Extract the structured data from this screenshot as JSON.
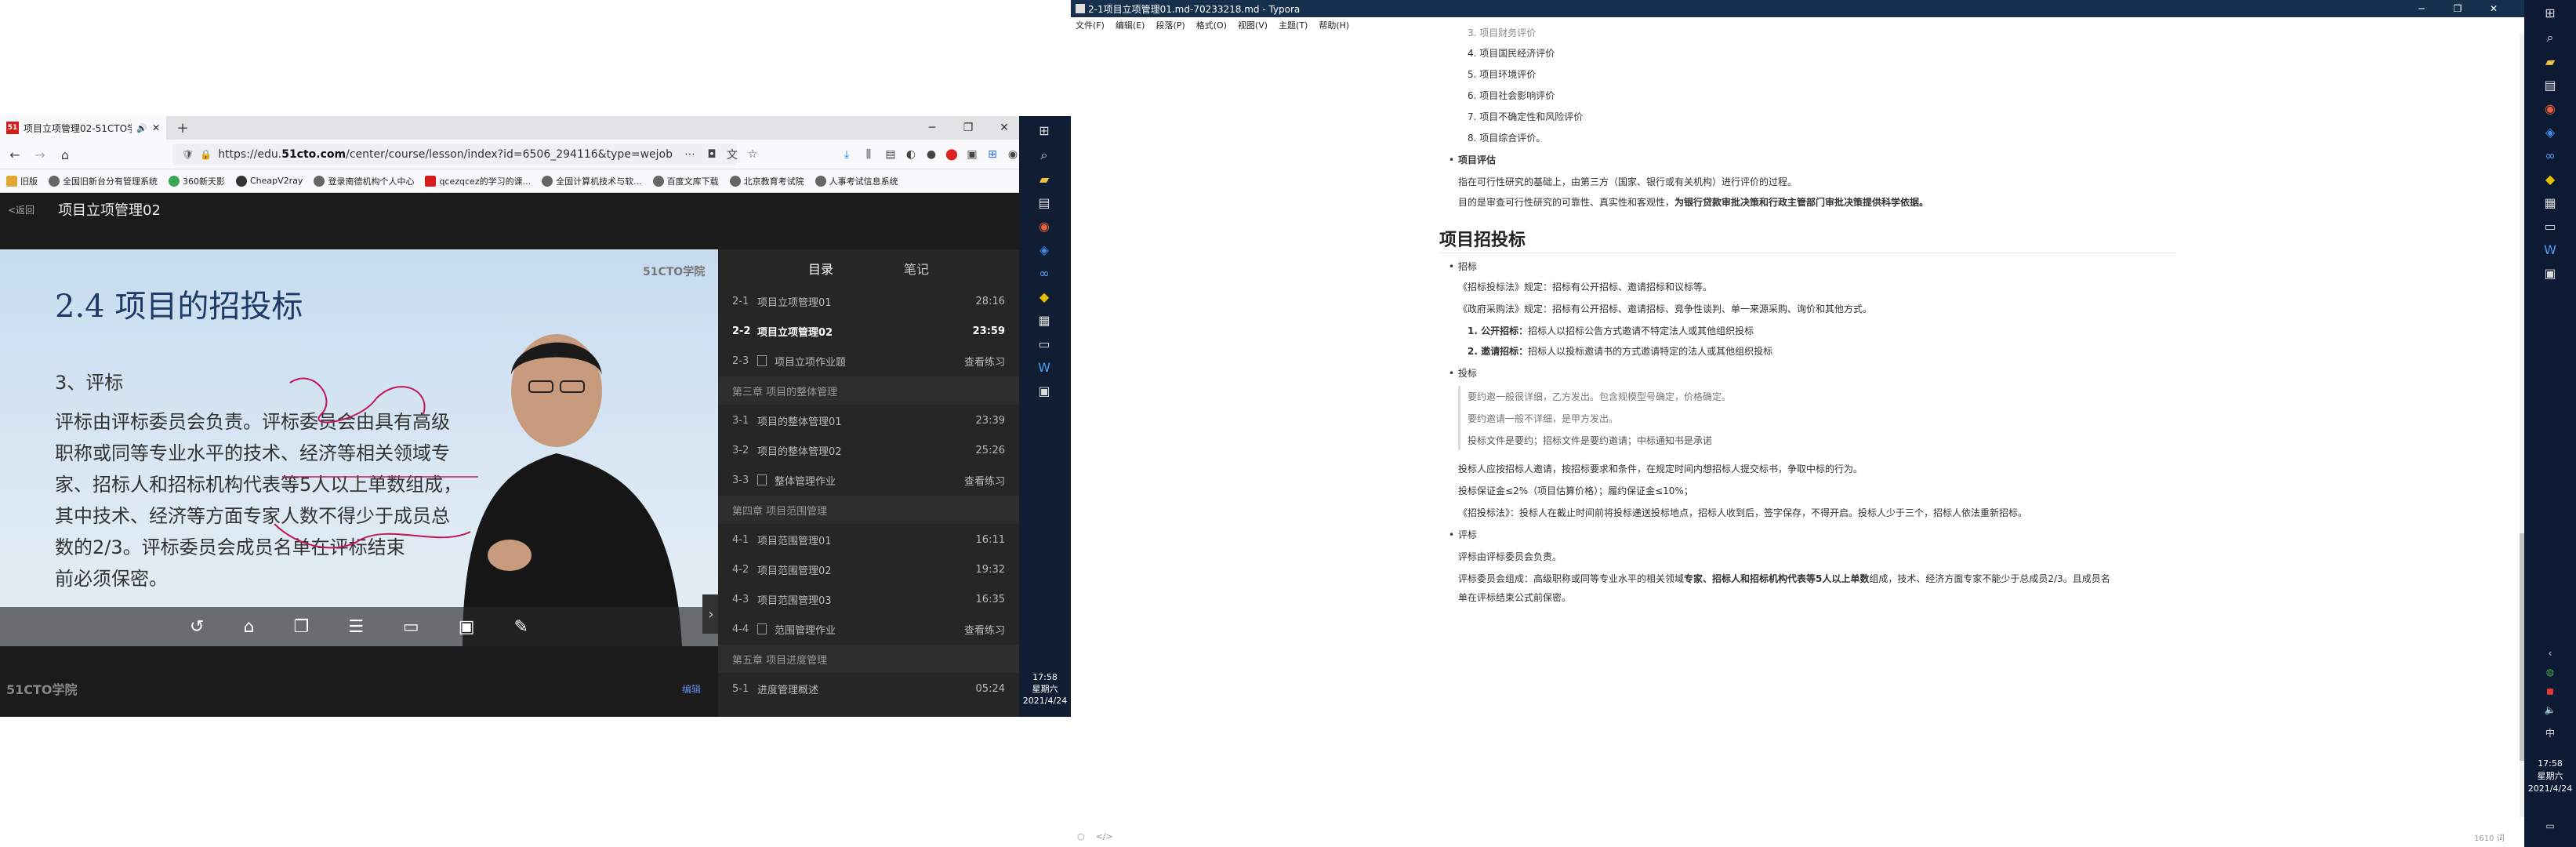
{
  "firefox": {
    "tab_title": "项目立项管理02-51CTO学",
    "url_prefix": "https://edu.",
    "url_host": "51cto.com",
    "url_path": "/center/course/lesson/index?id=6506_294116&type=wejob",
    "bookmarks": [
      "旧版",
      "全国旧新台分有管理系统",
      "360新天影",
      "CheapV2ray",
      "登录南德机构个人中心",
      "qcezqcez的学习的课...",
      "全国计算机技术与软...",
      "百度文库下载",
      "北京教育考试院",
      "人事考试信息系统"
    ]
  },
  "page": {
    "back_label": "<返回",
    "title": "项目立项管理02"
  },
  "video": {
    "slide_heading": "2.4   项目的招投标",
    "slide_logo": "51CTO学院",
    "slide_section": "3、评标",
    "slide_lines": [
      "评标由评标委员会负责。评标委员会由具有高级",
      "职称或同等专业水平的技术、经济等相关领域专",
      "家、招标人和招标机构代表等5人以上单数组成，",
      "其中技术、经济等方面专家人数不得少于成员总",
      "数的2/3。评标委员会成员名单在评标结束",
      "前必须保密。"
    ],
    "brand": "51CTO学院",
    "edit_label": "编辑"
  },
  "playlist": {
    "tabs": [
      "目录",
      "笔记"
    ],
    "items": [
      {
        "kind": "lesson",
        "num": "2-1",
        "name": "项目立项管理01",
        "right": "28:16",
        "current": false
      },
      {
        "kind": "lesson",
        "num": "2-2",
        "name": "项目立项管理02",
        "right": "23:59",
        "current": true
      },
      {
        "kind": "exercise",
        "num": "2-3",
        "name": "项目立项作业题",
        "right": "查看练习",
        "current": false
      },
      {
        "kind": "chapter",
        "name": "第三章 项目的整体管理"
      },
      {
        "kind": "lesson",
        "num": "3-1",
        "name": "项目的整体管理01",
        "right": "23:39",
        "current": false
      },
      {
        "kind": "lesson",
        "num": "3-2",
        "name": "项目的整体管理02",
        "right": "25:26",
        "current": false
      },
      {
        "kind": "exercise",
        "num": "3-3",
        "name": "整体管理作业",
        "right": "查看练习",
        "current": false
      },
      {
        "kind": "chapter",
        "name": "第四章 项目范围管理"
      },
      {
        "kind": "lesson",
        "num": "4-1",
        "name": "项目范围管理01",
        "right": "16:11",
        "current": false
      },
      {
        "kind": "lesson",
        "num": "4-2",
        "name": "项目范围管理02",
        "right": "19:32",
        "current": false
      },
      {
        "kind": "lesson",
        "num": "4-3",
        "name": "项目范围管理03",
        "right": "16:35",
        "current": false
      },
      {
        "kind": "exercise",
        "num": "4-4",
        "name": "范围管理作业",
        "right": "查看练习",
        "current": false
      },
      {
        "kind": "chapter",
        "name": "第五章 项目进度管理"
      },
      {
        "kind": "lesson",
        "num": "5-1",
        "name": "进度管理概述",
        "right": "05:24",
        "current": false
      }
    ]
  },
  "taskbar_left": {
    "time": "17:58",
    "weekday": "星期六",
    "date": "2021/4/24"
  },
  "typora": {
    "window_title": "2-1项目立项管理01.md-70233218.md - Typora",
    "menu": [
      "文件(F)",
      "编辑(E)",
      "段落(P)",
      "格式(O)",
      "视图(V)",
      "主题(T)",
      "帮助(H)"
    ],
    "doc": {
      "eval_items": [
        "3. 项目财务评价",
        "4. 项目国民经济评价",
        "5. 项目环境评价",
        "6. 项目社会影响评价",
        "7. 项目不确定性和风险评价",
        "8. 项目综合评价。"
      ],
      "assess_title": "项目评估",
      "assess_p1": "指在可行性研究的基础上，由第三方（国家、银行或有关机构）进行评价的过程。",
      "assess_p2a": "目的是审查可行性研究的可靠性、真实性和客观性，",
      "assess_p2b": "为银行贷款审批决策和行政主管部门审批决策提供科学依据。",
      "h2": "项目招投标",
      "bid_title": "招标",
      "bid_p1": "《招标投标法》规定：招标有公开招标、邀请招标和议标等。",
      "bid_p2": "《政府采购法》规定：招标有公开招标、邀请招标、竞争性谈判、单一来源采购、询价和其他方式。",
      "bid_o1a": "1. 公开招标：",
      "bid_o1b": "招标人以招标公告方式邀请不特定法人或其他组织投标",
      "bid_o2a": "2. 邀请招标：",
      "bid_o2b": "招标人以投标邀请书的方式邀请特定的法人或其他组织投标",
      "tender_title": "投标",
      "quote_1": "要约邀一般很详细，乙方发出。包含规模型号确定，价格确定。",
      "quote_2": "要约邀请一般不详细，是甲方发出。",
      "quote_3": "投标文件是要约；招标文件是要约邀请；中标通知书是承诺",
      "tender_p1": "投标人应按招标人邀请，按招标要求和条件，在规定时间内想招标人提交标书，争取中标的行为。",
      "tender_p2": "投标保证金≤2%（项目估算价格）；履约保证金≤10%；",
      "tender_p3": "《招投标法》：投标人在截止时间前将投标递送投标地点，招标人收到后，签字保存，不得开启。投标人少于三个，招标人依法重新招标。",
      "eval_title": "评标",
      "eval_p1": "评标由评标委员会负责。",
      "eval_p2a": "评标委员会组成：高级职称或同等专业水平的相关领域",
      "eval_p2b": "专家、招标人和招标机构代表等5人以上单数",
      "eval_p2c": "组成，技术、经济方面专家不能少于总成员2/3。且成员名",
      "eval_p2d": "单在评标结束公式前保密。"
    },
    "word_count": "1610 词"
  },
  "taskbar_right": {
    "time": "17:58",
    "weekday": "星期六",
    "date": "2021/4/24",
    "ime": "中"
  }
}
